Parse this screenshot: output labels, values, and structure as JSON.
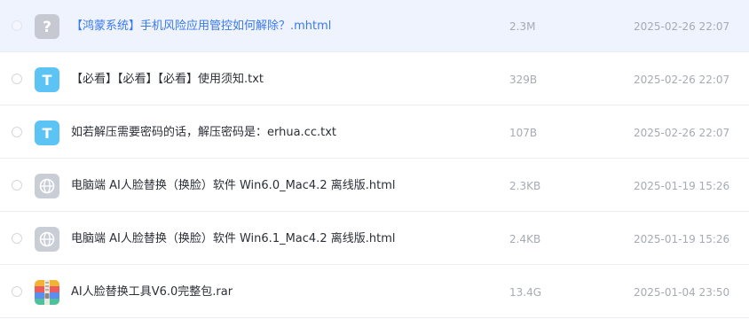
{
  "files": [
    {
      "name": "【鸿蒙系统】手机风险应用管控如何解除？.mhtml",
      "size": "2.3M",
      "modified": "2025-02-26 22:07",
      "icon": "unknown-file-icon",
      "icon_glyph": "?",
      "selected": true
    },
    {
      "name": "【必看】【必看】【必看】使用须知.txt",
      "size": "329B",
      "modified": "2025-02-26 22:07",
      "icon": "text-file-icon",
      "icon_glyph": "T",
      "selected": false
    },
    {
      "name": "如若解压需要密码的话，解压密码是：erhua.cc.txt",
      "size": "107B",
      "modified": "2025-02-26 22:07",
      "icon": "text-file-icon",
      "icon_glyph": "T",
      "selected": false
    },
    {
      "name": "电脑端 AI人脸替换（换脸）软件 Win6.0_Mac4.2 离线版.html",
      "size": "2.3KB",
      "modified": "2025-01-19 15:26",
      "icon": "web-file-icon",
      "selected": false
    },
    {
      "name": "电脑端 AI人脸替换（换脸）软件 Win6.1_Mac4.2 离线版.html",
      "size": "2.4KB",
      "modified": "2025-01-19 15:26",
      "icon": "web-file-icon",
      "selected": false
    },
    {
      "name": "AI人脸替换工具V6.0完整包.rar",
      "size": "13.4G",
      "modified": "2025-01-04 23:50",
      "icon": "archive-file-icon",
      "selected": false
    }
  ],
  "colors": {
    "selected_row_bg": "#eef3fd",
    "selected_name": "#3a7af0",
    "text_icon": "#5cc3f5",
    "unknown_icon": "#c6c9d1",
    "web_icon": "#c9cdd6",
    "meta_text": "#a6abb3"
  }
}
